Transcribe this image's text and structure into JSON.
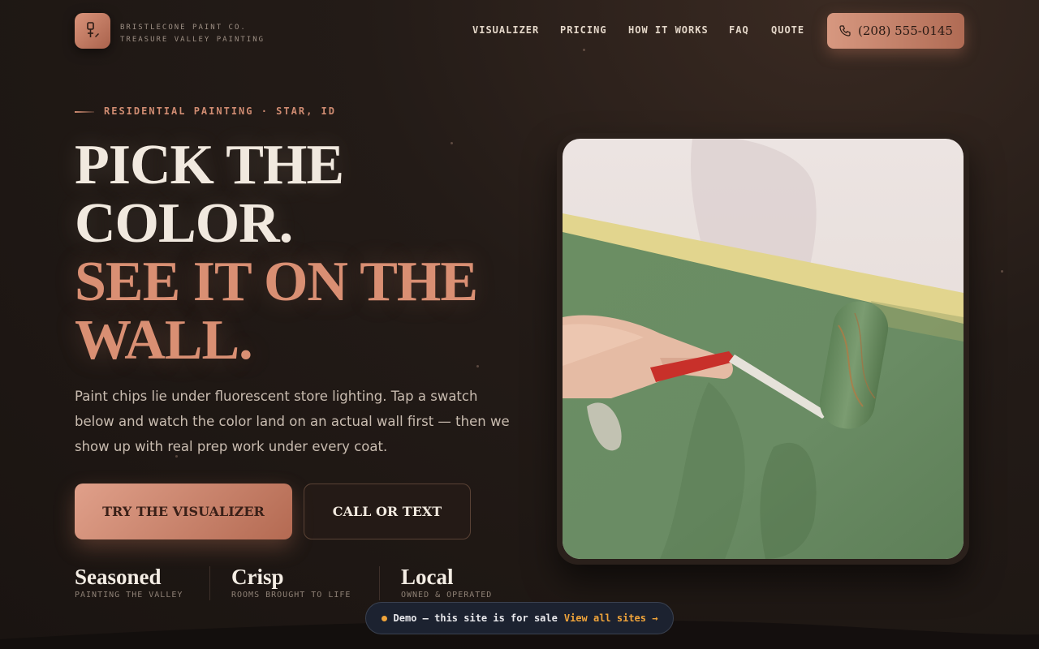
{
  "brand": {
    "line1": "BRISTLECONE PAINT CO.",
    "line2": "TREASURE VALLEY PAINTING",
    "logo_icon": "paint-brush-icon"
  },
  "nav": {
    "items": [
      {
        "label": "VISUALIZER"
      },
      {
        "label": "PRICING"
      },
      {
        "label": "HOW IT WORKS"
      },
      {
        "label": "FAQ"
      },
      {
        "label": "QUOTE"
      }
    ],
    "phone": "(208) 555-0145",
    "phone_icon": "phone-icon"
  },
  "hero": {
    "eyebrow": "RESIDENTIAL PAINTING · STAR, ID",
    "headline_lines": [
      "PICK THE",
      "COLOR.",
      "SEE IT ON THE",
      "WALL."
    ],
    "lead": "Paint chips lie under fluorescent store lighting. Tap a swatch below and watch the color land on an actual wall first — then we show up with real prep work under every coat.",
    "primary_cta": "TRY THE VISUALIZER",
    "secondary_cta": "CALL OR TEXT"
  },
  "stats": [
    {
      "title": "Seasoned",
      "sub": "PAINTING THE VALLEY"
    },
    {
      "title": "Crisp",
      "sub": "ROOMS BROUGHT TO LIFE"
    },
    {
      "title": "Local",
      "sub": "OWNED & OPERATED"
    }
  ],
  "demo": {
    "text": "Demo — this site is for sale",
    "link": "View all sites →"
  },
  "colors": {
    "accent": "#d98f73",
    "cream": "#f1e9df",
    "background": "#1d1613",
    "wall_green": "#6f9068",
    "demo_accent": "#f0a43a"
  }
}
